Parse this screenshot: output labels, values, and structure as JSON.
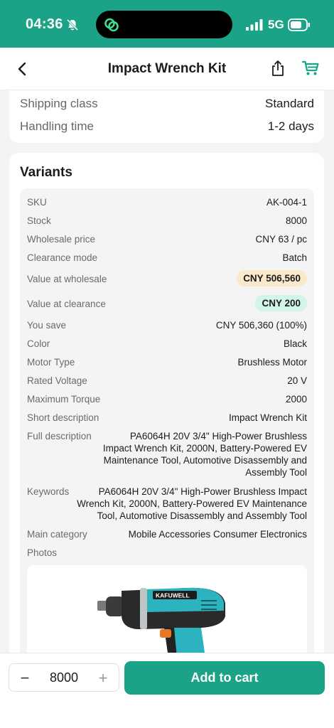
{
  "status_bar": {
    "time": "04:36",
    "network": "5G",
    "bell_icon": "bell-slash-icon",
    "signal_icon": "signal-bars-icon",
    "battery_icon": "battery-icon",
    "island_icon": "app-link-icon",
    "color": "#1aa386"
  },
  "nav": {
    "title": "Impact Wrench Kit",
    "back_icon": "chevron-left-icon",
    "share_icon": "share-icon",
    "cart_icon": "cart-icon"
  },
  "shipping": {
    "class_label": "Shipping class",
    "class_value": "Standard",
    "handling_label": "Handling time",
    "handling_value": "1-2 days"
  },
  "variants": {
    "heading": "Variants",
    "rows": [
      {
        "label": "SKU",
        "value": "AK-004-1"
      },
      {
        "label": "Stock",
        "value": "8000"
      },
      {
        "label": "Wholesale price",
        "value": "CNY 63 / pc"
      },
      {
        "label": "Clearance mode",
        "value": "Batch"
      },
      {
        "label": "Value at wholesale",
        "value": "CNY 506,560"
      },
      {
        "label": "Value at clearance",
        "value": "CNY 200"
      },
      {
        "label": "You save",
        "value": "CNY 506,360 (100%)"
      },
      {
        "label": "Color",
        "value": "Black"
      },
      {
        "label": "Motor Type",
        "value": "Brushless Motor"
      },
      {
        "label": "Rated Voltage",
        "value": "20 V"
      },
      {
        "label": "Maximum Torque",
        "value": "2000"
      },
      {
        "label": "Short description",
        "value": "Impact Wrench Kit"
      },
      {
        "label": "Full description",
        "value": "PA6064H 20V 3/4\" High-Power Brushless\nImpact Wrench Kit, 2000N, Battery-Powered EV\nMaintenance Tool, Automotive Disassembly and\nAssembly Tool"
      },
      {
        "label": "Keywords",
        "value": "PA6064H 20V 3/4\" High-Power Brushless Impact\nWrench Kit, 2000N, Battery-Powered EV Maintenance\nTool, Automotive Disassembly and Assembly Tool"
      },
      {
        "label": "Main category",
        "value": "Mobile Accessories Consumer Electronics"
      },
      {
        "label": "Photos",
        "value": ""
      }
    ],
    "photo_brand": "KAFUWELL"
  },
  "bottom": {
    "minus": "−",
    "quantity": "8000",
    "plus": "+",
    "add_to_cart": "Add to cart",
    "accent": "#1aa386"
  }
}
